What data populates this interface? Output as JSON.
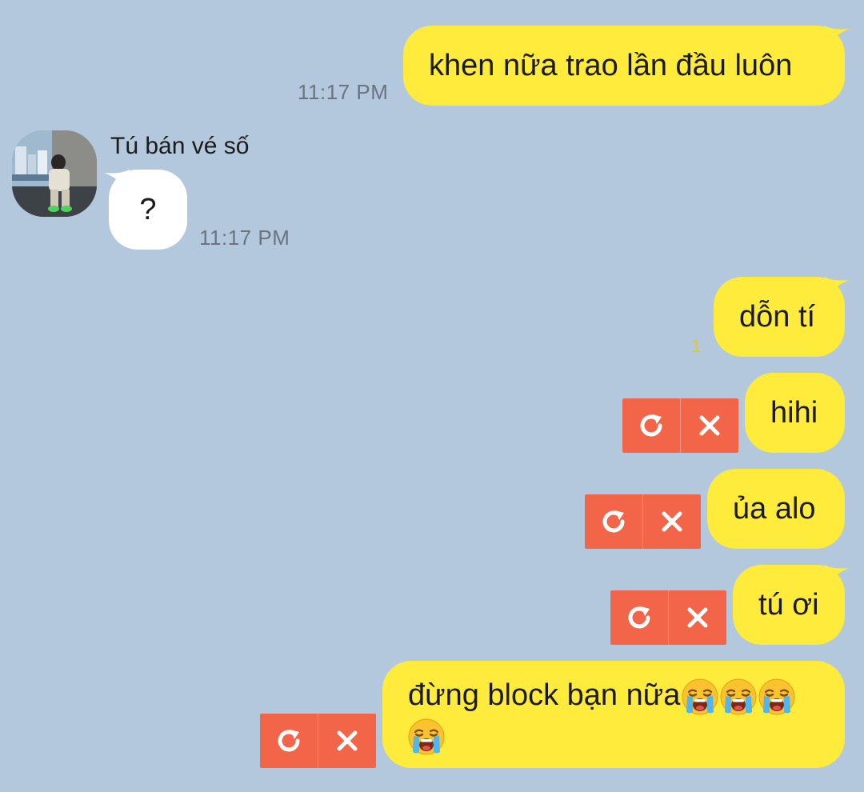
{
  "colors": {
    "background": "#b3c8dc",
    "outgoing_bubble": "#ffeb3b",
    "incoming_bubble": "#ffffff",
    "failed_action": "#f26548",
    "timestamp": "#6a7480",
    "unread_count": "#e7c42a"
  },
  "contact": {
    "name": "Tú bán vé số"
  },
  "messages": [
    {
      "direction": "outgoing",
      "text": "khen nữa trao lần đầu luôn",
      "time": "11:17 PM"
    },
    {
      "direction": "incoming",
      "text": "?",
      "time": "11:17 PM"
    },
    {
      "direction": "outgoing",
      "text": "dỗn tí",
      "unread": "1"
    },
    {
      "direction": "outgoing",
      "text": "hihi",
      "status": "failed"
    },
    {
      "direction": "outgoing",
      "text": "ủa alo",
      "status": "failed"
    },
    {
      "direction": "outgoing",
      "text": "tú ơi",
      "status": "failed"
    },
    {
      "direction": "outgoing",
      "text": "đừng block bạn nữa",
      "emoji": "loudly-crying-face",
      "emoji_count": 4,
      "status": "failed"
    }
  ],
  "failed_actions": {
    "resend_icon": "resend-icon",
    "delete_icon": "close-icon"
  }
}
